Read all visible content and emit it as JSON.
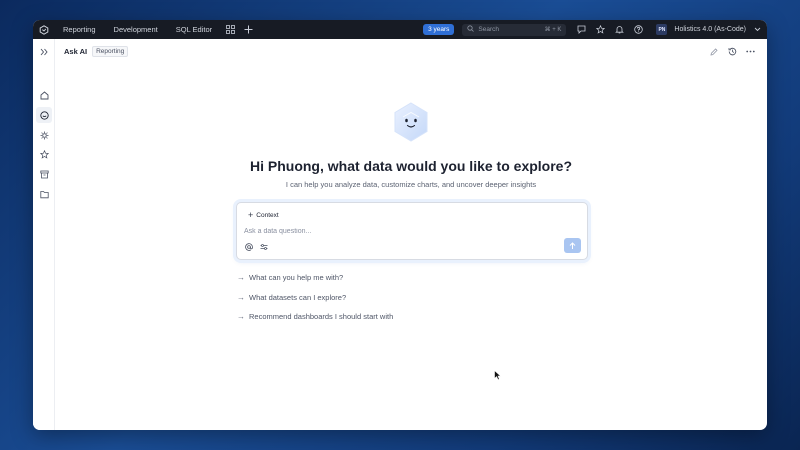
{
  "topbar": {
    "nav": [
      "Reporting",
      "Development",
      "SQL Editor"
    ],
    "badge": "3 years",
    "search_placeholder": "Search",
    "search_shortcut": "⌘ + K",
    "avatar_initials": "PN",
    "workspace": "Holistics 4.0 (As-Code)"
  },
  "header": {
    "title": "Ask AI",
    "tag": "Reporting"
  },
  "main": {
    "greeting": "Hi Phuong, what data would you like to explore?",
    "subtitle": "I can help you analyze data, customize charts, and uncover deeper insights",
    "context_label": "Context",
    "input_placeholder": "Ask a data question...",
    "suggestions": [
      "What can you help me with?",
      "What datasets can I explore?",
      "Recommend dashboards I should start with"
    ]
  },
  "colors": {
    "accent": "#2f6fd6",
    "topbar_bg": "#171b24",
    "send_button": "#a9c5f1",
    "background": "#123b7a"
  }
}
